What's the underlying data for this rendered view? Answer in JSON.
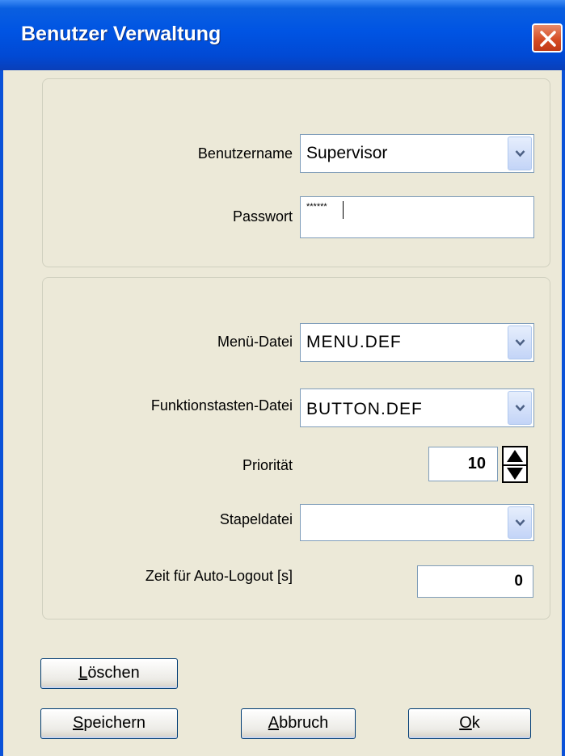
{
  "window": {
    "title": "Benutzer Verwaltung"
  },
  "login": {
    "username_label": "Benutzername",
    "username_value": "Supervisor",
    "password_label": "Passwort",
    "password_value": "******"
  },
  "settings": {
    "menu_label": "Menü-Datei",
    "menu_value": "MENU.DEF",
    "fkeys_label": "Funktionstasten-Datei",
    "fkeys_value": "BUTTON.DEF",
    "priority_label": "Priorität",
    "priority_value": "10",
    "batch_label": "Stapeldatei",
    "batch_value": "",
    "autologout_label": "Zeit für Auto-Logout [s]",
    "autologout_value": "0"
  },
  "buttons": {
    "delete_first": "L",
    "delete_rest": "öschen",
    "save_first": "S",
    "save_rest": "peichern",
    "cancel_first": "A",
    "cancel_rest": "bbruch",
    "ok_first": "O",
    "ok_rest": "k"
  },
  "colors": {
    "titlebar": "#0054e3",
    "close": "#d44a22",
    "dialog_bg": "#ece9d8",
    "field_border": "#7f9db9"
  }
}
